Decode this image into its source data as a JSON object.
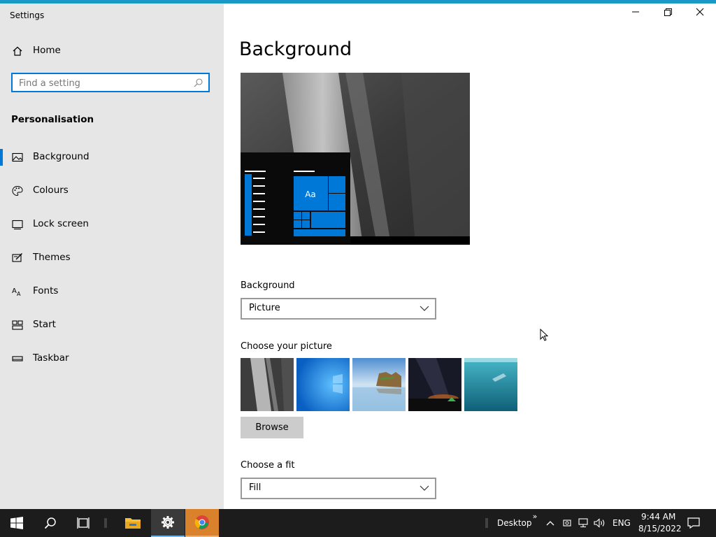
{
  "window": {
    "title": "Settings",
    "controls": {
      "minimize": "minimize-icon",
      "restore": "restore-icon",
      "close": "close-icon"
    }
  },
  "sidebar": {
    "home_label": "Home",
    "search_placeholder": "Find a setting",
    "section_title": "Personalisation",
    "items": [
      {
        "label": "Background",
        "icon": "picture-icon",
        "active": true
      },
      {
        "label": "Colours",
        "icon": "palette-icon",
        "active": false
      },
      {
        "label": "Lock screen",
        "icon": "lock-screen-icon",
        "active": false
      },
      {
        "label": "Themes",
        "icon": "themes-icon",
        "active": false
      },
      {
        "label": "Fonts",
        "icon": "fonts-icon",
        "active": false
      },
      {
        "label": "Start",
        "icon": "start-icon",
        "active": false
      },
      {
        "label": "Taskbar",
        "icon": "taskbar-icon",
        "active": false
      }
    ]
  },
  "main": {
    "title": "Background",
    "preview_tile_text": "Aa",
    "background_label": "Background",
    "background_value": "Picture",
    "choose_picture_label": "Choose your picture",
    "browse_label": "Browse",
    "fit_label": "Choose a fit",
    "fit_value": "Fill"
  },
  "taskbar": {
    "desktop_label": "Desktop",
    "language": "ENG",
    "time": "9:44 AM",
    "date": "8/15/2022",
    "icons": [
      "windows-start-icon",
      "search-icon",
      "task-view-icon",
      "file-explorer-icon",
      "settings-gear-icon",
      "chrome-icon"
    ]
  },
  "colors": {
    "accent": "#0078d7",
    "topbar": "#1a99c7",
    "sidebar_bg": "#e6e6e6",
    "taskbar_bg": "#1c1c1c"
  }
}
